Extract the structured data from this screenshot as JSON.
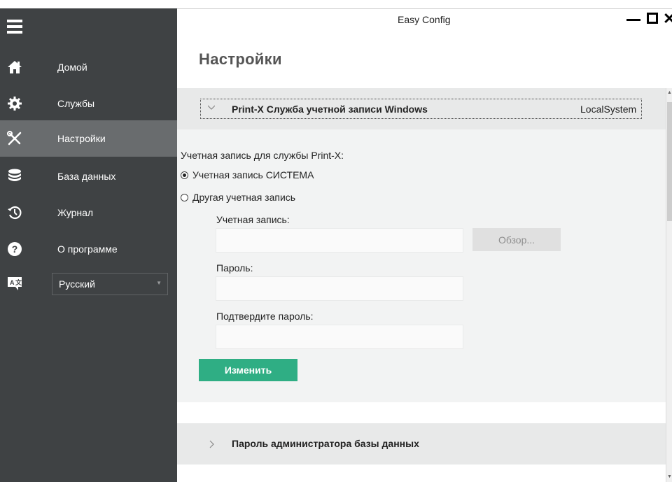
{
  "window": {
    "title": "Easy Config"
  },
  "sidebar": {
    "items": [
      {
        "label": "Домой",
        "icon": "home-icon"
      },
      {
        "label": "Службы",
        "icon": "gear-icon"
      },
      {
        "label": "Настройки",
        "icon": "tools-icon",
        "active": true
      },
      {
        "label": "База данных",
        "icon": "database-icon"
      },
      {
        "label": "Журнал",
        "icon": "history-icon"
      },
      {
        "label": "О программе",
        "icon": "help-icon"
      }
    ],
    "language": {
      "icon": "language-icon",
      "value": "Русский"
    }
  },
  "page": {
    "title": "Настройки"
  },
  "section1": {
    "title": "Print-X Служба учетной записи Windows",
    "value": "LocalSystem",
    "account_label": "Учетная запись для службы Print-X:",
    "radio_system": "Учетная запись СИСТЕМА",
    "radio_other": "Другая учетная запись",
    "account_field_label": "Учетная запись:",
    "browse_button": "Обзор...",
    "password_label": "Пароль:",
    "confirm_label": "Подтвердите пароль:",
    "change_button": "Изменить"
  },
  "section2": {
    "title": "Пароль администратора базы данных"
  },
  "colors": {
    "sidebar_bg": "#3f4244",
    "sidebar_active": "#696c6e",
    "accent_green": "#2fae84"
  }
}
